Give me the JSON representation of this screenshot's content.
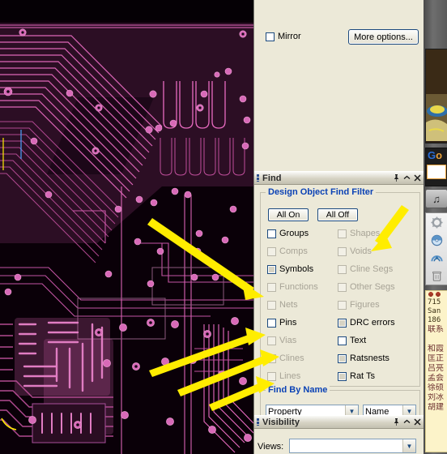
{
  "options_panel": {
    "mirror_label": "Mirror",
    "more_options_label": "More options..."
  },
  "find_panel": {
    "title": "Find",
    "titlebar_icons": {
      "pin": "pin-icon",
      "minimize": "chevron-up-icon",
      "close": "close-icon"
    },
    "filter_group": {
      "title": "Design Object Find Filter",
      "all_on_label": "All On",
      "all_off_label": "All Off",
      "left_column": [
        {
          "label": "Groups",
          "checked": false,
          "enabled": true
        },
        {
          "label": "Comps",
          "checked": false,
          "enabled": false
        },
        {
          "label": "Symbols",
          "checked": true,
          "enabled": true
        },
        {
          "label": "Functions",
          "checked": false,
          "enabled": false
        },
        {
          "label": "Nets",
          "checked": false,
          "enabled": false
        },
        {
          "label": "Pins",
          "checked": false,
          "enabled": true
        },
        {
          "label": "Vias",
          "checked": false,
          "enabled": false
        },
        {
          "label": "Clines",
          "checked": false,
          "enabled": false
        },
        {
          "label": "Lines",
          "checked": false,
          "enabled": false
        }
      ],
      "right_column": [
        {
          "label": "Shapes",
          "checked": false,
          "enabled": false
        },
        {
          "label": "Voids",
          "checked": false,
          "enabled": false
        },
        {
          "label": "Cline Segs",
          "checked": false,
          "enabled": false
        },
        {
          "label": "Other Segs",
          "checked": false,
          "enabled": false
        },
        {
          "label": "Figures",
          "checked": false,
          "enabled": false
        },
        {
          "label": "DRC errors",
          "checked": false,
          "enabled": true
        },
        {
          "label": "Text",
          "checked": false,
          "enabled": true
        },
        {
          "label": "Ratsnests",
          "checked": false,
          "enabled": true
        },
        {
          "label": "Rat Ts",
          "checked": false,
          "enabled": true
        }
      ]
    },
    "find_by_name_group": {
      "title": "Find By Name",
      "property_select_value": "Property",
      "name_select_value": "Name"
    }
  },
  "visibility_panel": {
    "title": "Visibility",
    "views_label": "Views:",
    "views_select_value": ""
  },
  "sidebar": {
    "google_gadget": {
      "text_blue": "G",
      "text_orange": "o",
      "search_input_value": ""
    },
    "music_gadget_icon": "music-note-icon",
    "icon_list": [
      "gear-icon",
      "disc-icon",
      "arc-icon",
      "trash-icon"
    ],
    "sticky_note": {
      "lines": [
        "715",
        "San",
        "186",
        "联系"
      ],
      "cn_lines": [
        "和霞",
        "匡正",
        "吕亮",
        "孟会",
        "徐硕",
        "刘冰",
        "胡建"
      ]
    }
  },
  "annotations": {
    "arrow_color": "#ffed00",
    "arrows": [
      {
        "name": "arrow-to-voids",
        "target": "Voids"
      },
      {
        "name": "arrow-to-functions",
        "target": "Functions"
      },
      {
        "name": "arrow-to-vias",
        "target": "Vias"
      },
      {
        "name": "arrow-to-clines",
        "target": "Clines"
      },
      {
        "name": "arrow-to-lines",
        "target": "Lines"
      }
    ]
  },
  "pcb_canvas": {
    "name": "pcb-layout-canvas",
    "background_color": "#0a0008",
    "trace_color": "#e86bc0",
    "plane_color": "#3a1830",
    "pad_color": "#d86ab8"
  }
}
